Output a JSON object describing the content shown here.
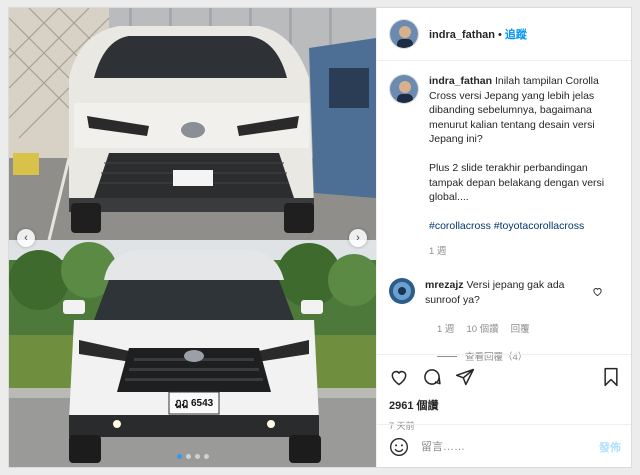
{
  "post": {
    "username": "indra_fathan",
    "separator": "•",
    "follow_label": "追蹤"
  },
  "caption": {
    "username": "indra_fathan",
    "text": "Inilah tampilan Corolla Cross versi Jepang yang lebih jelas dibanding sebelumnya, bagaimana menurut kalian tentang desain versi Jepang ini?",
    "paragraph2": "Plus 2 slide terakhir perbandingan tampak depan belakang dengan versi global....",
    "hashtags": "#corollacross #toyotacorollacross",
    "time": "1 週"
  },
  "comment": {
    "username": "mrezajz",
    "text": "Versi jepang gak ada sunroof ya?",
    "time": "1 週",
    "likes": "10 個讚",
    "reply": "回覆",
    "view_replies": "查看回覆（4）"
  },
  "actions": {
    "like_count": "2961 個讚",
    "time_ago": "7 天前"
  },
  "composer": {
    "placeholder": "留言……",
    "post_label": "發佈"
  },
  "carousel": {
    "slide_count": 4,
    "active_slide": 1,
    "plate_text": "ฎฎ 6543",
    "plate_sub": "กรุงเทพมหานคร"
  },
  "colors": {
    "link_blue": "#0095f6",
    "hashtag": "#00376b",
    "muted": "#8e8e8e",
    "post_disabled": "#b2dffc"
  }
}
